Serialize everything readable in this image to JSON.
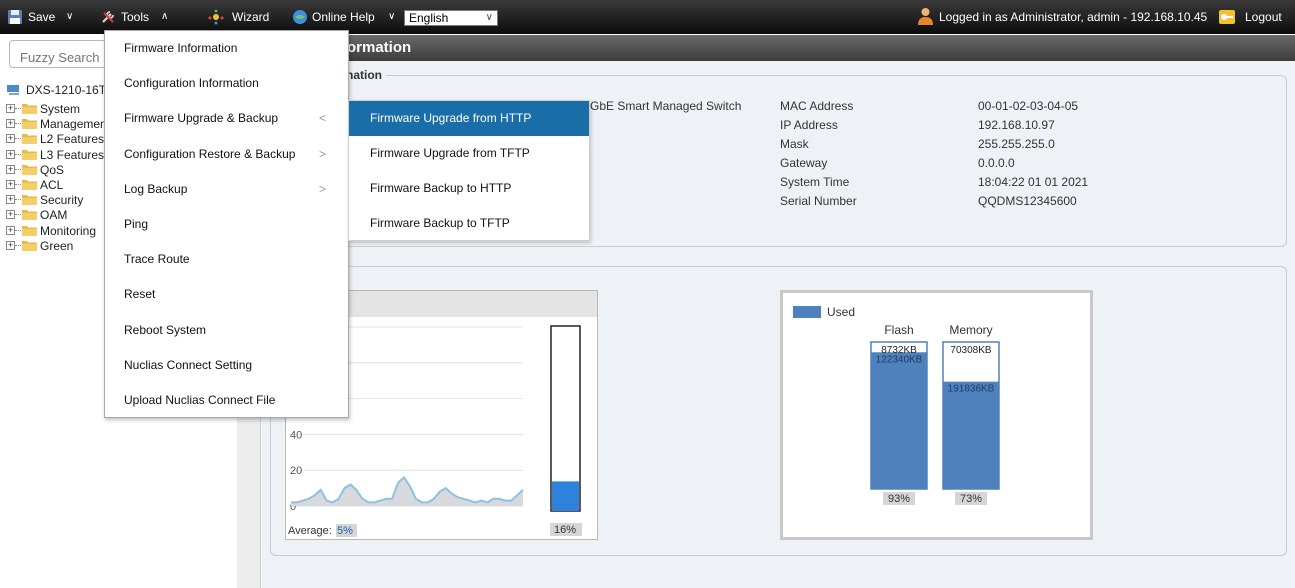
{
  "toolbar": {
    "save_label": "Save",
    "tools_label": "Tools",
    "wizard_label": "Wizard",
    "online_help_label": "Online Help",
    "language_value": "English",
    "logged_in_text": "Logged in as Administrator, admin - 192.168.10.45",
    "logout_label": "Logout"
  },
  "sidebar": {
    "search_placeholder": "Fuzzy Search",
    "device_name": "DXS-1210-16T",
    "items": [
      {
        "label": "System"
      },
      {
        "label": "Management"
      },
      {
        "label": "L2 Features"
      },
      {
        "label": "L3 Features"
      },
      {
        "label": "QoS"
      },
      {
        "label": "ACL"
      },
      {
        "label": "Security"
      },
      {
        "label": "OAM"
      },
      {
        "label": "Monitoring"
      },
      {
        "label": "Green"
      }
    ]
  },
  "content": {
    "title": "ormation",
    "fieldset_legend": "nation",
    "device_type_tail": "GbE Smart Managed Switch",
    "info_rows": [
      {
        "label": "MAC Address",
        "value": "00-01-02-03-04-05"
      },
      {
        "label": "IP Address",
        "value": "192.168.10.97"
      },
      {
        "label": "Mask",
        "value": "255.255.255.0"
      },
      {
        "label": "Gateway",
        "value": "0.0.0.0"
      },
      {
        "label": "System Time",
        "value": "18:04:22 01 01 2021"
      },
      {
        "label": "Serial Number",
        "value": "QQDMS12345600"
      }
    ]
  },
  "tools_menu": {
    "items": [
      {
        "label": "Firmware Information"
      },
      {
        "label": "Configuration Information"
      },
      {
        "label": "Firmware Upgrade & Backup",
        "arrow": "<"
      },
      {
        "label": "Configuration Restore & Backup",
        "arrow": ">"
      },
      {
        "label": "Log Backup",
        "arrow": ">"
      },
      {
        "label": "Ping"
      },
      {
        "label": "Trace Route"
      },
      {
        "label": "Reset"
      },
      {
        "label": "Reboot System"
      },
      {
        "label": "Nuclias Connect Setting"
      },
      {
        "label": "Upload Nuclias Connect File"
      }
    ],
    "submenu": [
      {
        "label": "Firmware Upgrade from HTTP",
        "active": true
      },
      {
        "label": "Firmware Upgrade from TFTP"
      },
      {
        "label": "Firmware Backup to HTTP"
      },
      {
        "label": "Firmware Backup to TFTP"
      }
    ]
  },
  "colors": {
    "toolbar_bg": "#1b1b1b",
    "menu_active": "#1a6ea8",
    "used_bar": "#4f81bd",
    "cpu_line": "#8ec0e3",
    "cpu_bar": "#2f82dc"
  },
  "chart_data": [
    {
      "type": "area",
      "ylim": [
        0,
        100
      ],
      "yticks": [
        "0",
        "20",
        "40"
      ],
      "values": [
        2,
        2,
        3,
        4,
        6,
        9,
        3,
        2,
        4,
        10,
        12,
        9,
        4,
        2,
        2,
        3,
        4,
        4,
        13,
        16,
        11,
        4,
        2,
        2,
        4,
        8,
        10,
        7,
        5,
        4,
        3,
        2,
        3,
        2,
        4,
        4,
        3,
        3,
        6,
        9
      ],
      "average_label": "Average:",
      "average_value": "5%",
      "current_value": 16,
      "current_label": "16%"
    },
    {
      "type": "bar",
      "legend": "Used",
      "categories": [
        "Flash",
        "Memory"
      ],
      "free_labels": [
        "8732KB",
        "70308KB"
      ],
      "used_labels": [
        "122340KB",
        "191836KB"
      ],
      "used_percent": [
        93,
        73
      ],
      "percent_labels": [
        "93%",
        "73%"
      ]
    }
  ]
}
